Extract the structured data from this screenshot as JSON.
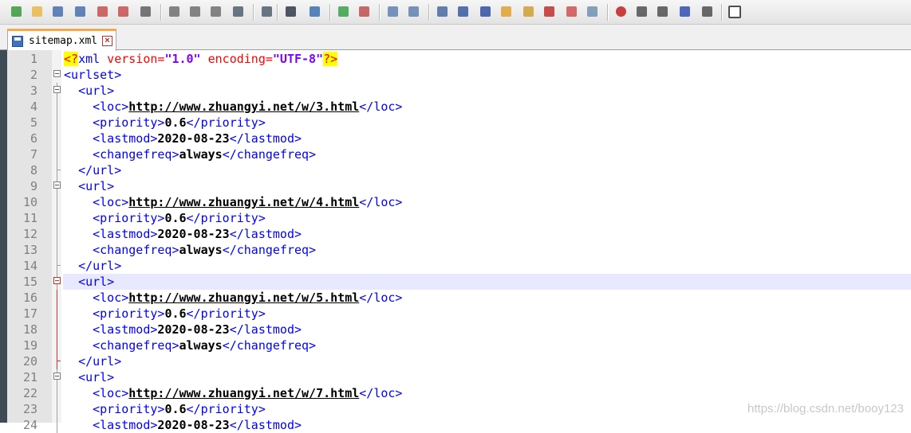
{
  "toolbar": {
    "icons": [
      "new-file-icon",
      "open-file-icon",
      "save-icon",
      "save-all-icon",
      "close-icon",
      "close-all-icon",
      "print-icon",
      "cut-icon",
      "copy-icon",
      "paste-icon",
      "undo-icon",
      "redo-icon",
      "find-icon",
      "replace-icon",
      "zoom-in-icon",
      "zoom-out-icon",
      "sync-vertical-icon",
      "sync-horizontal-icon",
      "word-wrap-icon",
      "show-all-chars-icon",
      "indent-guide-icon",
      "udl-icon",
      "doc-map-icon",
      "function-list-icon",
      "folder-workspace-icon",
      "monitoring-icon",
      "record-macro-icon",
      "stop-macro-icon",
      "playback-macro-icon",
      "run-macro-multiple-icon",
      "save-macro-icon",
      "console-icon"
    ]
  },
  "tab": {
    "label": "sitemap.xml",
    "close": "×"
  },
  "lines": [
    {
      "n": "1"
    },
    {
      "n": "2"
    },
    {
      "n": "3"
    },
    {
      "n": "4"
    },
    {
      "n": "5"
    },
    {
      "n": "6"
    },
    {
      "n": "7"
    },
    {
      "n": "8"
    },
    {
      "n": "9"
    },
    {
      "n": "10"
    },
    {
      "n": "11"
    },
    {
      "n": "12"
    },
    {
      "n": "13"
    },
    {
      "n": "14"
    },
    {
      "n": "15"
    },
    {
      "n": "16"
    },
    {
      "n": "17"
    },
    {
      "n": "18"
    },
    {
      "n": "19"
    },
    {
      "n": "20"
    },
    {
      "n": "21"
    },
    {
      "n": "22"
    },
    {
      "n": "23"
    },
    {
      "n": "24"
    }
  ],
  "xml": {
    "pi_open": "<?",
    "pi_name": "xml",
    "attr_version": " version=",
    "val_version": "\"1.0\"",
    "attr_encoding": " encoding=",
    "val_encoding": "\"UTF-8\"",
    "pi_close": "?>",
    "urlset_open": "<urlset>",
    "url_open": "<url>",
    "url_close": "</url>",
    "loc_open": "<loc>",
    "loc_close": "</loc>",
    "priority_open": "<priority>",
    "priority_close": "</priority>",
    "lastmod_open": "<lastmod>",
    "lastmod_close": "</lastmod>",
    "changefreq_open": "<changefreq>",
    "changefreq_close": "</changefreq>"
  },
  "entries": [
    {
      "loc": "http://www.zhuangyi.net/w/3.html",
      "priority": "0.6",
      "lastmod": "2020-08-23",
      "changefreq": "always"
    },
    {
      "loc": "http://www.zhuangyi.net/w/4.html",
      "priority": "0.6",
      "lastmod": "2020-08-23",
      "changefreq": "always"
    },
    {
      "loc": "http://www.zhuangyi.net/w/5.html",
      "priority": "0.6",
      "lastmod": "2020-08-23",
      "changefreq": "always"
    },
    {
      "loc": "http://www.zhuangyi.net/w/7.html",
      "priority": "0.6",
      "lastmod": "2020-08-23",
      "changefreq": "always"
    }
  ],
  "watermark": "https://blog.csdn.net/booy123"
}
